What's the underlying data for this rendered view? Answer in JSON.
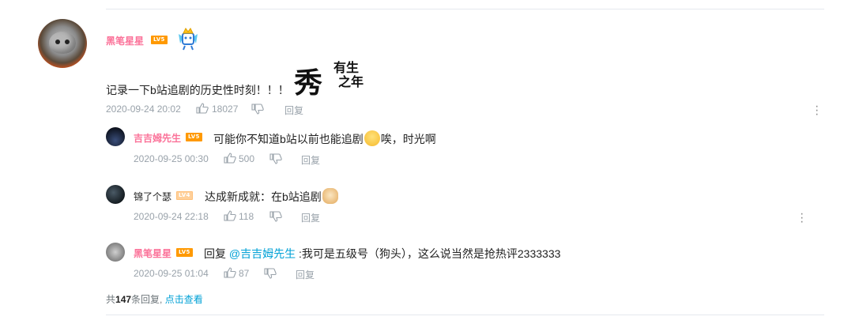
{
  "main_comment": {
    "username": "黑笔星星",
    "level": "LV5",
    "text": "记录一下b站追剧的历史性时刻！！！",
    "sticker_text_1": "秀",
    "sticker_text_2a": "有生",
    "sticker_text_2b": "之年",
    "date": "2020-09-24 20:02",
    "likes": "18027",
    "reply_label": "回复"
  },
  "replies": [
    {
      "username": "吉吉姆先生",
      "level": "LV5",
      "text_before": "可能你不知道b站以前也能追剧",
      "text_after": "唉，时光啊",
      "date": "2020-09-25 00:30",
      "likes": "500",
      "reply_label": "回复"
    },
    {
      "username": "锦了个瑟",
      "level": "LV4",
      "text_before": "达成新成就：在b站追剧",
      "date": "2020-09-24 22:18",
      "likes": "118",
      "reply_label": "回复"
    },
    {
      "username": "黑笔星星",
      "level": "LV5",
      "reply_prefix": "回复",
      "mention": "@吉吉姆先生",
      "text_after": ":我可是五级号（狗头），这么说当然是抢热评2333333",
      "date": "2020-09-25 01:04",
      "likes": "87",
      "reply_label": "回复"
    }
  ],
  "summary": {
    "prefix": "共",
    "count": "147",
    "suffix": "条回复,",
    "link": "点击查看"
  },
  "colors": {
    "vip_name": "#fb7299",
    "meta": "#99a2aa",
    "link": "#00a1d6",
    "level_badge": "#ff9900"
  }
}
